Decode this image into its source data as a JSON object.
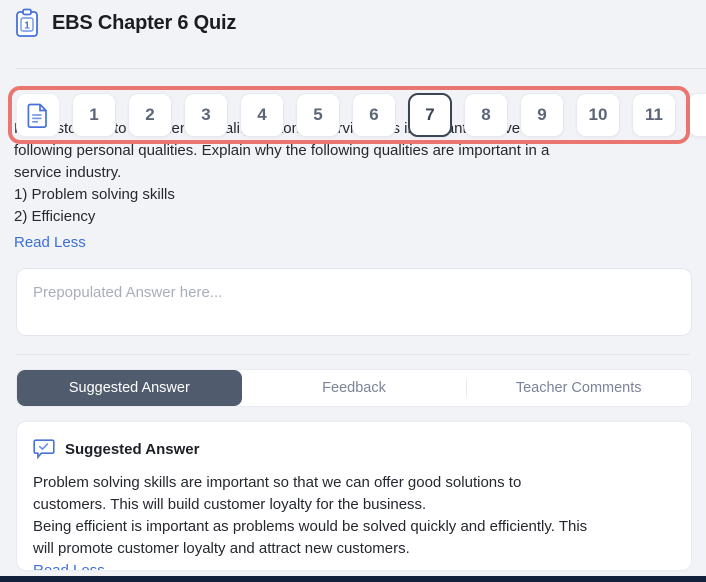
{
  "header": {
    "icon": "clipboard-one-icon",
    "title": "EBS Chapter 6 Quiz"
  },
  "question_nav": {
    "overview_icon": "document-icon",
    "items": [
      "1",
      "2",
      "3",
      "4",
      "5",
      "6",
      "7",
      "8",
      "9",
      "10",
      "11"
    ],
    "current": "7",
    "highlight_color": "#eb7671",
    "partial_item": ""
  },
  "question": {
    "lines": [
      "For customers to experience quality customer service, it is important to have the",
      "following personal qualities. Explain why the following qualities are important in a",
      "service industry.",
      "1) Problem solving skills",
      "2) Efficiency"
    ],
    "toggle_label": "Read Less"
  },
  "answer_input": {
    "value": "",
    "placeholder": "Prepopulated Answer here..."
  },
  "tabs": {
    "items": [
      {
        "label": "Suggested Answer",
        "active": true
      },
      {
        "label": "Feedback",
        "active": false
      },
      {
        "label": "Teacher Comments",
        "active": false
      }
    ],
    "active_bg": "#505b6d"
  },
  "suggested_answer": {
    "icon": "speech-bubble-check-icon",
    "title": "Suggested Answer",
    "lines": [
      "Problem solving skills are important so that we can offer good solutions to",
      "customers. This will build customer loyalty for the business.",
      "Being efficient is important as problems would be solved quickly and efficiently. This",
      "will promote customer loyalty and attract new customers."
    ],
    "toggle_label": "Read Less"
  }
}
